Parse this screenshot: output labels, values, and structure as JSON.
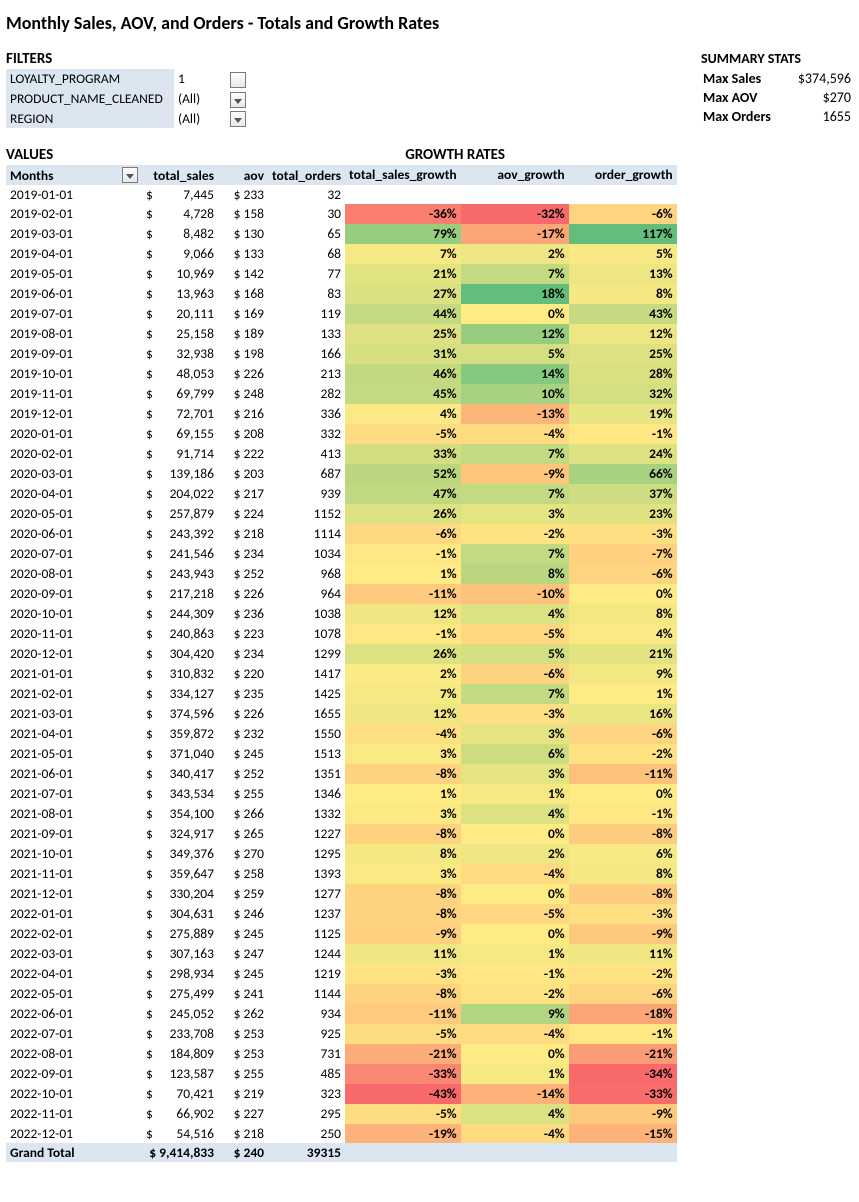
{
  "title": "Monthly Sales, AOV, and Orders - Totals and Growth Rates",
  "filters": {
    "heading": "FILTERS",
    "rows": [
      {
        "name": "LOYALTY_PROGRAM",
        "value": "1",
        "btn": "funnel"
      },
      {
        "name": "PRODUCT_NAME_CLEANED",
        "value": "(All)",
        "btn": "arrow"
      },
      {
        "name": "REGION",
        "value": "(All)",
        "btn": "arrow"
      }
    ]
  },
  "summary": {
    "heading": "SUMMARY STATS",
    "rows": [
      {
        "label": "Max Sales",
        "value": "$374,596"
      },
      {
        "label": "Max AOV",
        "value": "$270"
      },
      {
        "label": "Max Orders",
        "value": "1655"
      }
    ]
  },
  "values_heading": "VALUES",
  "growth_heading": "GROWTH RATES",
  "headers": {
    "months": "Months",
    "total_sales": "total_sales",
    "aov": "aov",
    "total_orders": "total_orders",
    "total_sales_growth": "total_sales_growth",
    "aov_growth": "aov_growth",
    "order_growth": "order_growth"
  },
  "grand_total": {
    "label": "Grand Total",
    "total_sales": "$ 9,414,833",
    "aov": "$ 240",
    "total_orders": "39315"
  },
  "chart_data": {
    "type": "table",
    "columns": [
      "month",
      "total_sales",
      "aov",
      "total_orders",
      "total_sales_growth",
      "aov_growth",
      "order_growth"
    ],
    "rows": [
      [
        "2019-01-01",
        7445,
        233,
        32,
        null,
        null,
        null
      ],
      [
        "2019-02-01",
        4728,
        158,
        30,
        -36,
        -32,
        -6
      ],
      [
        "2019-03-01",
        8482,
        130,
        65,
        79,
        -17,
        117
      ],
      [
        "2019-04-01",
        9066,
        133,
        68,
        7,
        2,
        5
      ],
      [
        "2019-05-01",
        10969,
        142,
        77,
        21,
        7,
        13
      ],
      [
        "2019-06-01",
        13963,
        168,
        83,
        27,
        18,
        8
      ],
      [
        "2019-07-01",
        20111,
        169,
        119,
        44,
        0,
        43
      ],
      [
        "2019-08-01",
        25158,
        189,
        133,
        25,
        12,
        12
      ],
      [
        "2019-09-01",
        32938,
        198,
        166,
        31,
        5,
        25
      ],
      [
        "2019-10-01",
        48053,
        226,
        213,
        46,
        14,
        28
      ],
      [
        "2019-11-01",
        69799,
        248,
        282,
        45,
        10,
        32
      ],
      [
        "2019-12-01",
        72701,
        216,
        336,
        4,
        -13,
        19
      ],
      [
        "2020-01-01",
        69155,
        208,
        332,
        -5,
        -4,
        -1
      ],
      [
        "2020-02-01",
        91714,
        222,
        413,
        33,
        7,
        24
      ],
      [
        "2020-03-01",
        139186,
        203,
        687,
        52,
        -9,
        66
      ],
      [
        "2020-04-01",
        204022,
        217,
        939,
        47,
        7,
        37
      ],
      [
        "2020-05-01",
        257879,
        224,
        1152,
        26,
        3,
        23
      ],
      [
        "2020-06-01",
        243392,
        218,
        1114,
        -6,
        -2,
        -3
      ],
      [
        "2020-07-01",
        241546,
        234,
        1034,
        -1,
        7,
        -7
      ],
      [
        "2020-08-01",
        243943,
        252,
        968,
        1,
        8,
        -6
      ],
      [
        "2020-09-01",
        217218,
        226,
        964,
        -11,
        -10,
        0
      ],
      [
        "2020-10-01",
        244309,
        236,
        1038,
        12,
        4,
        8
      ],
      [
        "2020-11-01",
        240863,
        223,
        1078,
        -1,
        -5,
        4
      ],
      [
        "2020-12-01",
        304420,
        234,
        1299,
        26,
        5,
        21
      ],
      [
        "2021-01-01",
        310832,
        220,
        1417,
        2,
        -6,
        9
      ],
      [
        "2021-02-01",
        334127,
        235,
        1425,
        7,
        7,
        1
      ],
      [
        "2021-03-01",
        374596,
        226,
        1655,
        12,
        -3,
        16
      ],
      [
        "2021-04-01",
        359872,
        232,
        1550,
        -4,
        3,
        -6
      ],
      [
        "2021-05-01",
        371040,
        245,
        1513,
        3,
        6,
        -2
      ],
      [
        "2021-06-01",
        340417,
        252,
        1351,
        -8,
        3,
        -11
      ],
      [
        "2021-07-01",
        343534,
        255,
        1346,
        1,
        1,
        0
      ],
      [
        "2021-08-01",
        354100,
        266,
        1332,
        3,
        4,
        -1
      ],
      [
        "2021-09-01",
        324917,
        265,
        1227,
        -8,
        0,
        -8
      ],
      [
        "2021-10-01",
        349376,
        270,
        1295,
        8,
        2,
        6
      ],
      [
        "2021-11-01",
        359647,
        258,
        1393,
        3,
        -4,
        8
      ],
      [
        "2021-12-01",
        330204,
        259,
        1277,
        -8,
        0,
        -8
      ],
      [
        "2022-01-01",
        304631,
        246,
        1237,
        -8,
        -5,
        -3
      ],
      [
        "2022-02-01",
        275889,
        245,
        1125,
        -9,
        0,
        -9
      ],
      [
        "2022-03-01",
        307163,
        247,
        1244,
        11,
        1,
        11
      ],
      [
        "2022-04-01",
        298934,
        245,
        1219,
        -3,
        -1,
        -2
      ],
      [
        "2022-05-01",
        275499,
        241,
        1144,
        -8,
        -2,
        -6
      ],
      [
        "2022-06-01",
        245052,
        262,
        934,
        -11,
        9,
        -18
      ],
      [
        "2022-07-01",
        233708,
        253,
        925,
        -5,
        -4,
        -1
      ],
      [
        "2022-08-01",
        184809,
        253,
        731,
        -21,
        0,
        -21
      ],
      [
        "2022-09-01",
        123587,
        255,
        485,
        -33,
        1,
        -34
      ],
      [
        "2022-10-01",
        70421,
        219,
        323,
        -43,
        -14,
        -33
      ],
      [
        "2022-11-01",
        66902,
        227,
        295,
        -5,
        4,
        -9
      ],
      [
        "2022-12-01",
        54516,
        218,
        250,
        -19,
        -4,
        -15
      ]
    ],
    "color_scale": {
      "type": "diverging",
      "min_color": "#F8696B",
      "mid_color": "#FFEB84",
      "max_color": "#63BE7B",
      "sales_growth_range": [
        -43,
        117
      ],
      "aov_growth_range": [
        -32,
        18
      ],
      "order_growth_range": [
        -34,
        117
      ]
    }
  }
}
